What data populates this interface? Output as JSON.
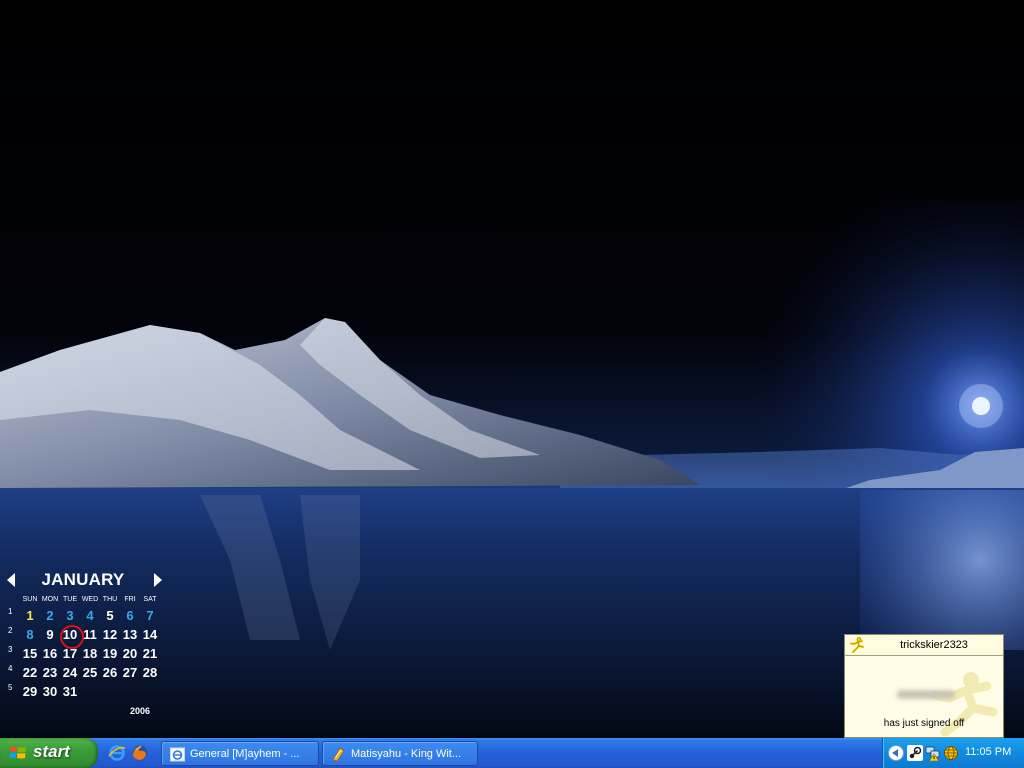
{
  "calendar": {
    "month": "JANUARY",
    "year": "2006",
    "weekdays": [
      "SUN",
      "MON",
      "TUE",
      "WED",
      "THU",
      "FRI",
      "SAT"
    ],
    "weeks": [
      {
        "num": "1",
        "days": [
          null,
          "1",
          "2",
          "3",
          "4",
          "5",
          "6",
          "7"
        ]
      },
      {
        "num": "2",
        "days": [
          null,
          "8",
          "9",
          "10",
          "11",
          "12",
          "13",
          "14"
        ]
      },
      {
        "num": "3",
        "days": [
          null,
          "15",
          "16",
          "17",
          "18",
          "19",
          "20",
          "21"
        ]
      },
      {
        "num": "4",
        "days": [
          null,
          "22",
          "23",
          "24",
          "25",
          "26",
          "27",
          "28"
        ]
      },
      {
        "num": "5",
        "days": [
          null,
          "29",
          "30",
          "31"
        ]
      }
    ],
    "today": "10",
    "colors": {
      "normal": "#ffffff",
      "highlight_yellow": "#f5e84a",
      "highlight_blue": "#38a8e8",
      "today_ring": "#e01010"
    }
  },
  "aim_toast": {
    "screenname": "trickskier2323",
    "message": "has just signed off"
  },
  "taskbar": {
    "start_label": "start",
    "quick_launch": [
      "internet-explorer-icon",
      "firefox-icon"
    ],
    "tasks": [
      {
        "label": "General [M]ayhem - ...",
        "icon": "ie-window-icon"
      },
      {
        "label": "Matisyahu - King Wit...",
        "icon": "winamp-icon"
      }
    ],
    "tray_icons": [
      "steam-icon",
      "network-warning-icon",
      "globe-icon"
    ],
    "clock": "11:05 PM"
  }
}
